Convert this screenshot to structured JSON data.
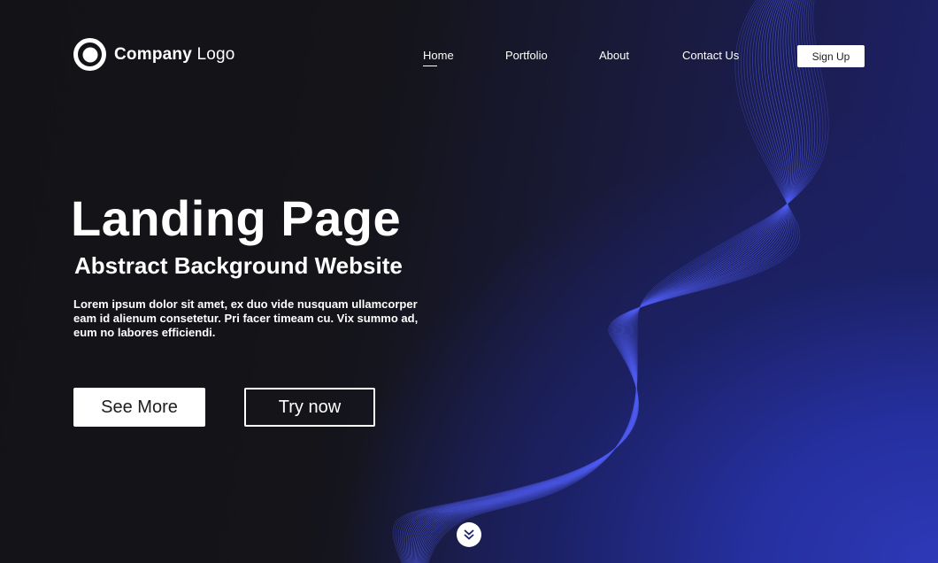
{
  "brand": {
    "logo_bold": "Company",
    "logo_light": "Logo"
  },
  "nav": {
    "items": [
      {
        "label": "Home",
        "active": true
      },
      {
        "label": "Portfolio",
        "active": false
      },
      {
        "label": "About",
        "active": false
      },
      {
        "label": "Contact Us",
        "active": false
      }
    ],
    "signup_label": "Sign Up"
  },
  "hero": {
    "title": "Landing Page",
    "subtitle": "Abstract Background Website",
    "body": "Lorem ipsum dolor sit amet, ex duo vide nusquam ullamcorper eam id alienum consetetur. Pri facer timeam cu. Vix summo ad, eum no labores efficiendi.",
    "primary_button": "See More",
    "secondary_button": "Try now"
  },
  "icons": {
    "logo": "ring-logo-icon",
    "scroll": "double-chevron-down-icon"
  },
  "colors": {
    "background_dark": "#131317",
    "background_blue": "#2d39b8",
    "wave_line": "#4f5cf2",
    "text": "#ffffff"
  }
}
